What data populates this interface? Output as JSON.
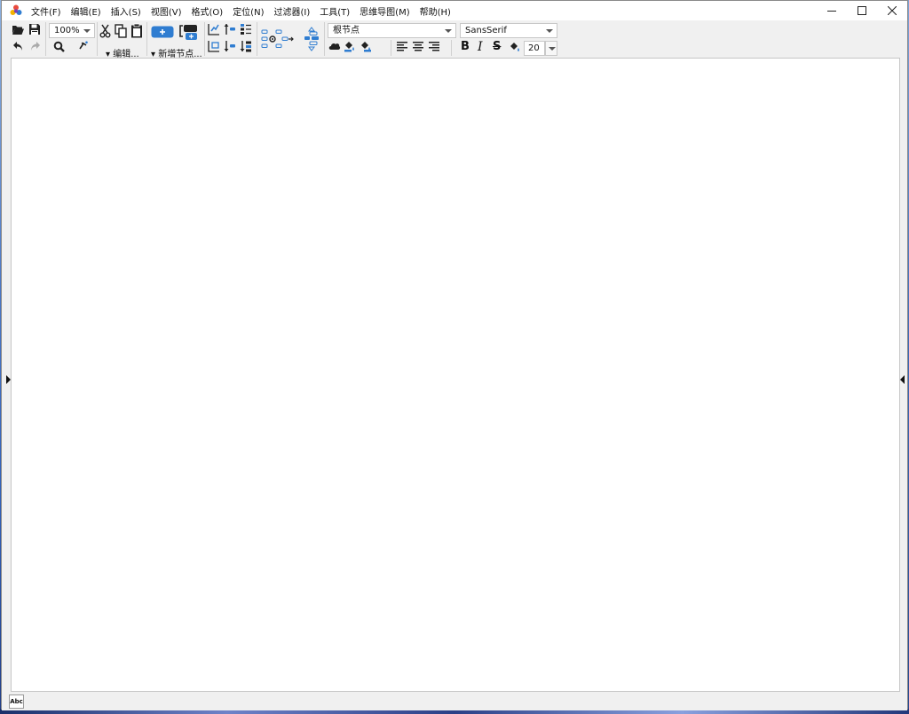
{
  "menu": [
    "文件(F)",
    "编辑(E)",
    "插入(S)",
    "视图(V)",
    "格式(O)",
    "定位(N)",
    "过滤器(I)",
    "工具(T)",
    "思维导图(M)",
    "帮助(H)"
  ],
  "window_controls": {
    "minimize": "—",
    "maximize": "☐",
    "close": "✕"
  },
  "toolbar": {
    "zoom_value": "100%",
    "edit_menu_label": "▾ 编辑...",
    "new_node_label": "▾ 新增节点...",
    "node_style_value": "根节点",
    "font_family_value": "SansSerif",
    "font_size_value": "20",
    "bold_label": "B",
    "italic_label": "I",
    "strike_label": "S"
  },
  "status": {
    "abc_label": "Abc"
  },
  "colors": {
    "accent": "#2f7dd1",
    "icon_dark": "#222222",
    "canvas": "#ffffff"
  }
}
